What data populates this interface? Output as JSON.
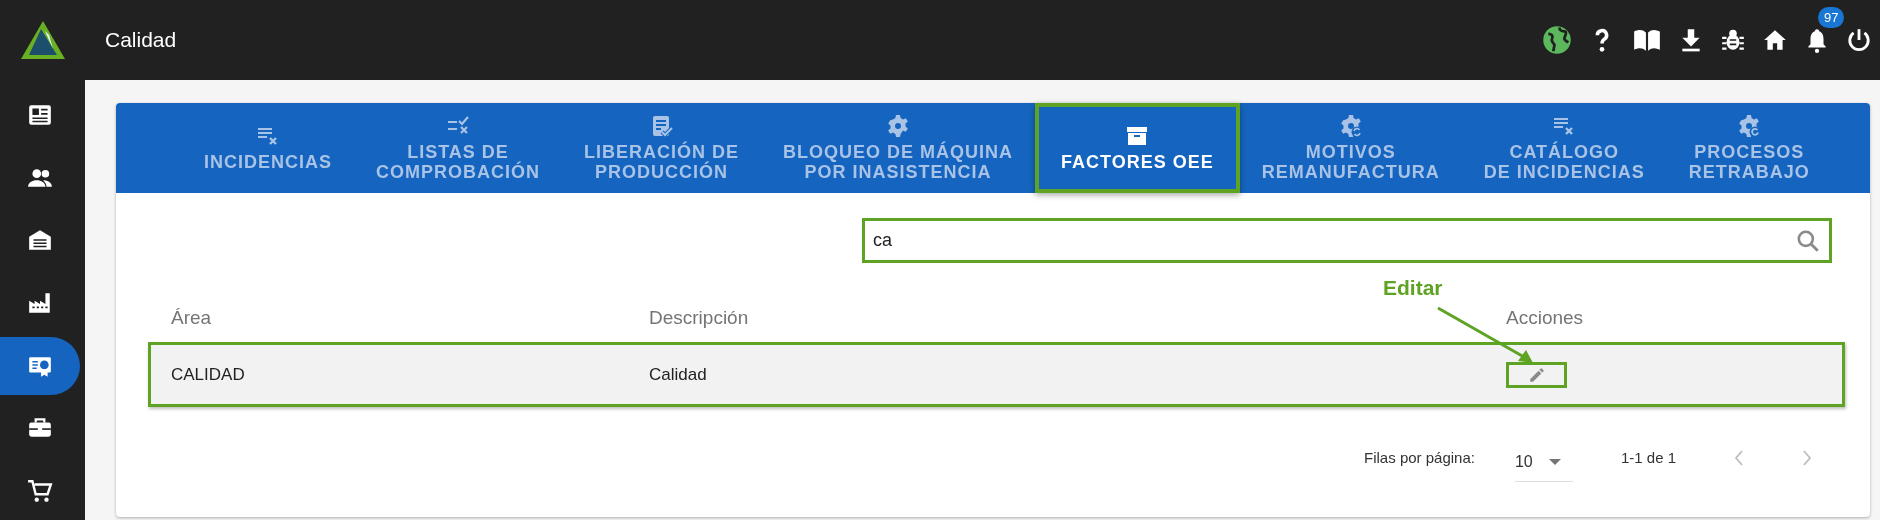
{
  "app_bar": {
    "title": "Calidad",
    "notifications": "97"
  },
  "sidebar": {
    "items": [
      {
        "selected": false
      },
      {
        "selected": false
      },
      {
        "selected": false
      },
      {
        "selected": false
      },
      {
        "selected": true
      },
      {
        "selected": false
      },
      {
        "selected": false
      }
    ]
  },
  "tabs": [
    {
      "label": "INCIDENCIAS",
      "selected": false,
      "highlighted": false
    },
    {
      "label": "LISTAS DE\nCOMPROBACIÓN",
      "selected": false,
      "highlighted": false
    },
    {
      "label": "LIBERACIÓN DE\nPRODUCCIÓN",
      "selected": false,
      "highlighted": false
    },
    {
      "label": "BLOQUEO DE MÁQUINA\nPOR INASISTENCIA",
      "selected": false,
      "highlighted": false
    },
    {
      "label": "FACTORES OEE",
      "selected": true,
      "highlighted": true
    },
    {
      "label": "MOTIVOS\nREMANUFACTURA",
      "selected": false,
      "highlighted": false
    },
    {
      "label": "CATÁLOGO\nDE INCIDENCIAS",
      "selected": false,
      "highlighted": false
    },
    {
      "label": "PROCESOS\nRETRABAJO",
      "selected": false,
      "highlighted": false
    }
  ],
  "search": {
    "value": "ca",
    "highlighted": true
  },
  "table": {
    "columns": [
      "Área",
      "Descripción",
      "Acciones"
    ],
    "rows": [
      {
        "cells": [
          "CALIDAD",
          "Calidad"
        ],
        "highlighted": true,
        "edit_highlighted": true
      }
    ]
  },
  "annotation": {
    "label": "Editar"
  },
  "pagination": {
    "rows_per_page_label": "Filas por página:",
    "rows_per_page": "10",
    "range": "1-1 de 1"
  }
}
